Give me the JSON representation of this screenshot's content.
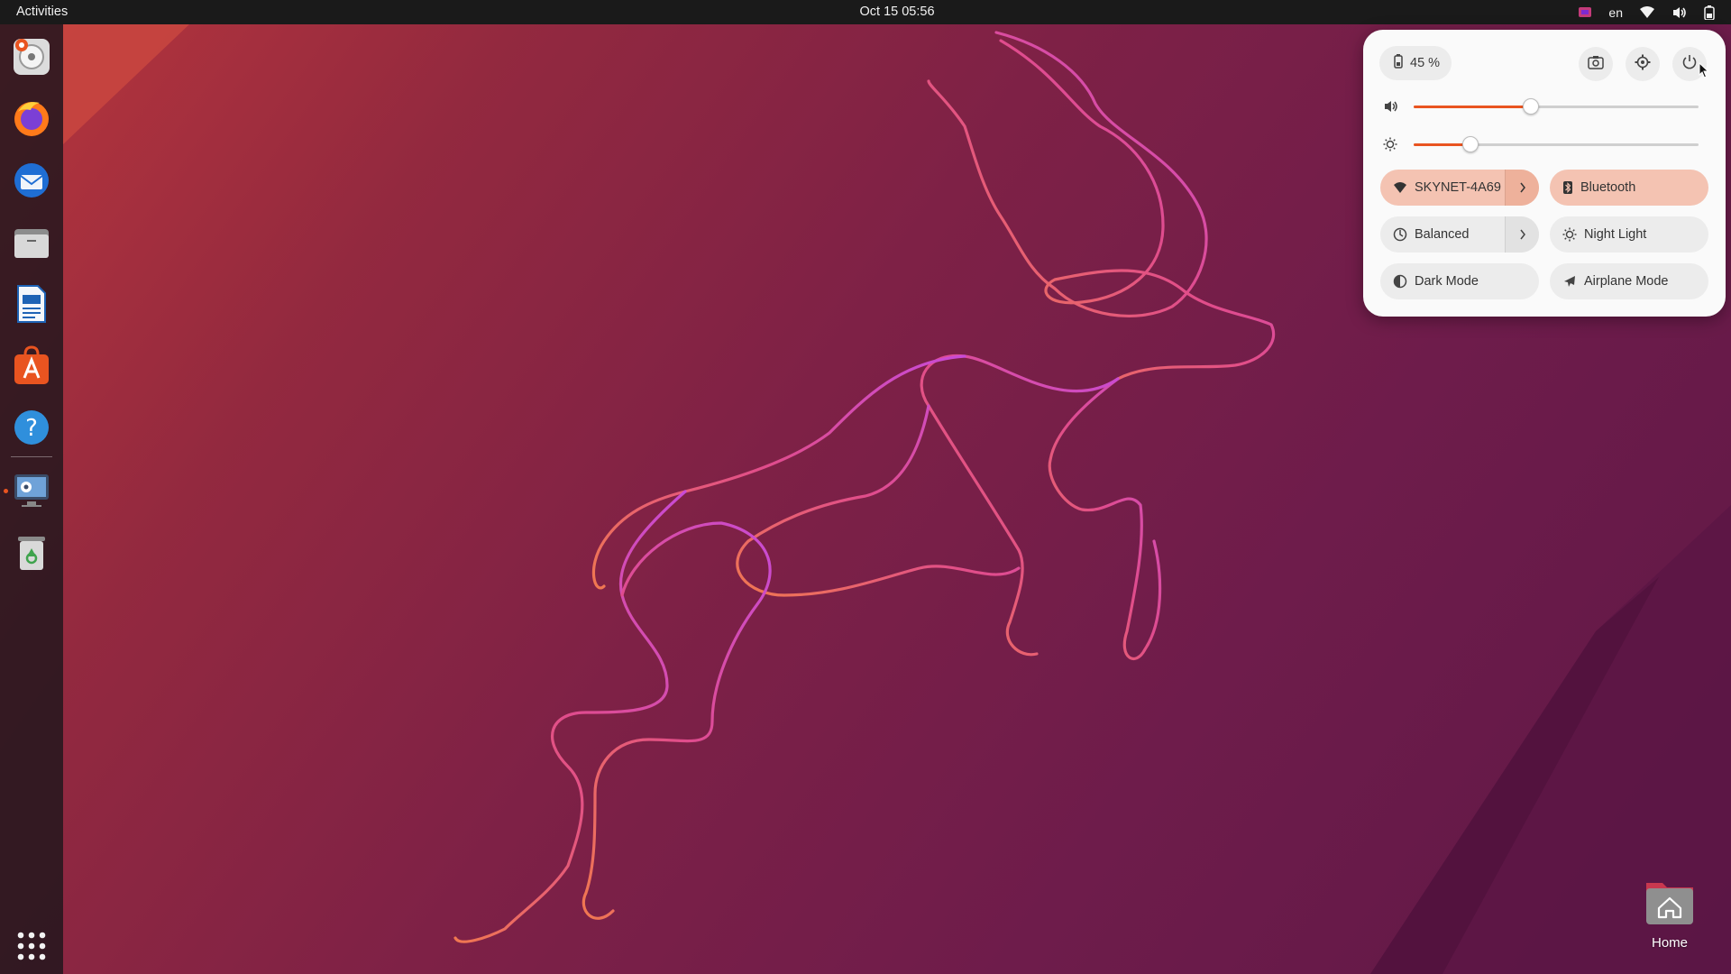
{
  "topbar": {
    "activities": "Activities",
    "clock": "Oct 15  05:56",
    "lang": "en",
    "tray_icons": [
      "app-indicator-icon",
      "wifi-icon",
      "volume-icon",
      "battery-icon"
    ]
  },
  "dock": {
    "apps": [
      {
        "name": "ubuntu-installer",
        "icon": "installer-icon"
      },
      {
        "name": "firefox",
        "icon": "firefox-icon"
      },
      {
        "name": "thunderbird",
        "icon": "thunderbird-icon"
      },
      {
        "name": "files",
        "icon": "files-icon"
      },
      {
        "name": "libreoffice-writer",
        "icon": "writer-icon"
      },
      {
        "name": "app-center",
        "icon": "app-center-icon"
      },
      {
        "name": "help",
        "icon": "help-icon"
      },
      {
        "name": "display-settings",
        "icon": "display-icon",
        "running": true
      },
      {
        "name": "trash",
        "icon": "trash-icon"
      }
    ],
    "show_apps_icon": "apps-grid-icon"
  },
  "desktop": {
    "home_label": "Home"
  },
  "quick_settings": {
    "battery": "45 %",
    "buttons": [
      "screenshot-icon",
      "settings-icon",
      "power-icon"
    ],
    "volume_level": 0.41,
    "brightness_level": 0.2,
    "toggles": {
      "wifi": {
        "label": "SKYNET-4A69",
        "active": true,
        "has_menu": true
      },
      "bluetooth": {
        "label": "Bluetooth",
        "active": true
      },
      "power_mode": {
        "label": "Balanced",
        "active": false,
        "has_menu": true
      },
      "night_light": {
        "label": "Night Light",
        "active": false
      },
      "dark_mode": {
        "label": "Dark Mode",
        "active": false
      },
      "airplane": {
        "label": "Airplane Mode",
        "active": false
      }
    },
    "accent_color": "#e95420"
  }
}
